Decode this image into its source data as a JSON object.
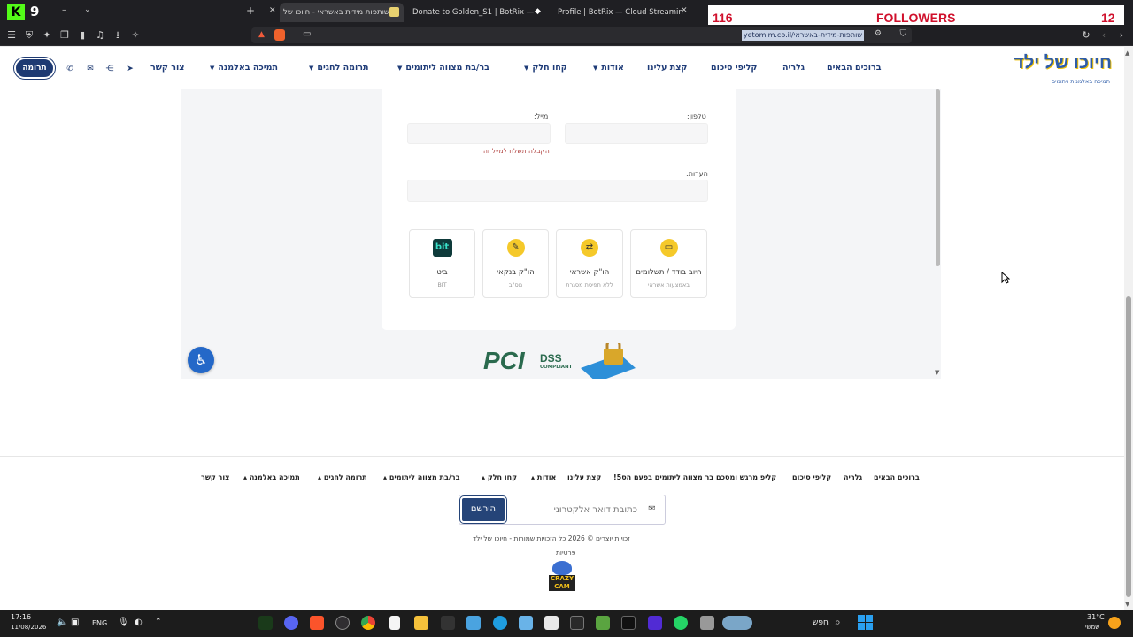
{
  "browser": {
    "tabs": [
      {
        "title": "שותפות מידית באשראי - חיוכו של",
        "active": true
      },
      {
        "title": "Donate to Golden_S1 | BotRix — Clo",
        "active": false
      },
      {
        "title": "Profile | BotRix — Cloud Streaming B",
        "active": false
      }
    ],
    "url": "yetomim.co.il/שותפות-מידית-באשראי",
    "kick_count": "9"
  },
  "overlay": {
    "followers_count": "116",
    "followers_label": "FOLLOWERS",
    "right_value": "12"
  },
  "header": {
    "donate_label": "תרומה",
    "nav": [
      {
        "label": "ברוכים הבאים",
        "dropdown": false
      },
      {
        "label": "גלריה",
        "dropdown": false
      },
      {
        "label": "קליפי סיכום",
        "dropdown": false
      },
      {
        "label": "קצת עלינו",
        "dropdown": false
      },
      {
        "label": "אודות",
        "dropdown": true
      },
      {
        "label": "קחו חלק",
        "dropdown": true
      },
      {
        "label": "בר/בת מצווה ליתומים",
        "dropdown": true
      },
      {
        "label": "תרומה לחגים",
        "dropdown": true
      },
      {
        "label": "תמיכה באלמנה",
        "dropdown": true
      },
      {
        "label": "צור קשר",
        "dropdown": false
      }
    ],
    "logo_text": "חיוכו של ילד",
    "logo_sub": "תמיכה באלמנות ויתומים"
  },
  "form": {
    "phone_label": "טלפון:",
    "email_label": "מייל:",
    "email_hint": "הקבלה תשלח למייל זה",
    "notes_label": "הערות:",
    "payment_methods": [
      {
        "title": "חיוב בודד / תשלומים",
        "sub": "באמצעות אשראי",
        "icon": "credit-card-icon"
      },
      {
        "title": "הו\"ק אשראי",
        "sub": "ללא תפיסת מסגרת",
        "icon": "recurring-icon"
      },
      {
        "title": "הו\"ק בנקאי",
        "sub": "מס\"ב",
        "icon": "bank-icon"
      },
      {
        "title": "ביט",
        "sub": "BIT",
        "icon": "bit-icon"
      }
    ],
    "bit_logo": "bit",
    "pci_text": "PCI",
    "dss_text": "DSS",
    "compliant_text": "COMPLIANT"
  },
  "footer": {
    "nav": [
      {
        "label": "ברוכים הבאים",
        "dropdown": false
      },
      {
        "label": "גלריה",
        "dropdown": false
      },
      {
        "label": "קליפי סיכום",
        "dropdown": false
      },
      {
        "label": "קליפ מרגש ומסכם בר מצווה ליתומים בפעם הס5!",
        "dropdown": false
      },
      {
        "label": "קצת עלינו",
        "dropdown": false
      },
      {
        "label": "אודות",
        "dropdown": true
      },
      {
        "label": "קחו חלק",
        "dropdown": true
      },
      {
        "label": "בר/בת מצווה ליתומים",
        "dropdown": true
      },
      {
        "label": "תרומה לחגים",
        "dropdown": true
      },
      {
        "label": "תמיכה באלמנה",
        "dropdown": true
      },
      {
        "label": "צור קשר",
        "dropdown": false
      }
    ],
    "email_placeholder": "כתובת דואר אלקטרוני",
    "subscribe_label": "הירשם",
    "copyright": "זכויות יוצרים © 2026 כל הזכויות שמורות - חיוכו של ילד",
    "privacy": "פרטיות",
    "crazy_cam": "CRAZY CAM"
  },
  "taskbar": {
    "time": "17:16",
    "date": "11/08/2026",
    "lang": "ENG",
    "search": "חפש",
    "weather": "31°C",
    "weather_sub": "שמשי"
  }
}
